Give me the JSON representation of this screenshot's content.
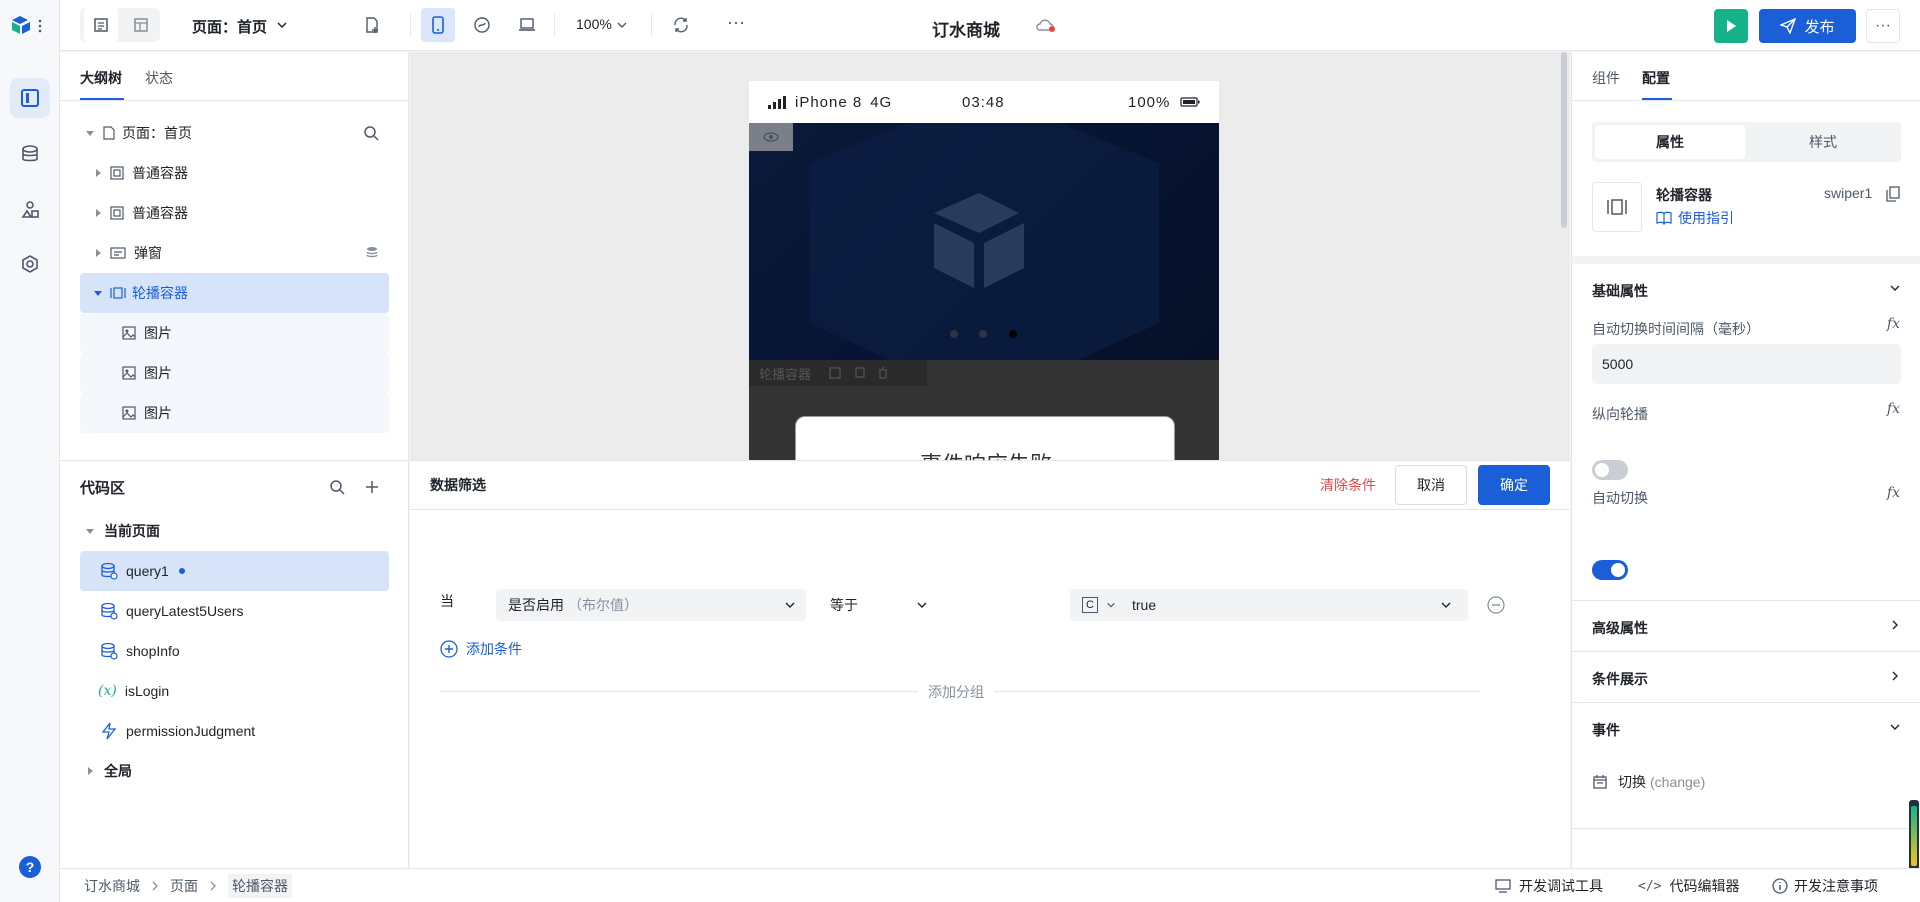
{
  "app": {
    "title": "订水商城"
  },
  "toolbar": {
    "page_selector": "页面：首页",
    "zoom": "100%",
    "more": "···",
    "publish_label": "发布"
  },
  "outline": {
    "tabs": [
      "大纲树",
      "状态"
    ],
    "root": "页面：首页",
    "items": [
      {
        "label": "普通容器"
      },
      {
        "label": "普通容器"
      },
      {
        "label": "弹窗"
      },
      {
        "label": "轮播容器"
      },
      {
        "label": "图片"
      },
      {
        "label": "图片"
      },
      {
        "label": "图片"
      }
    ]
  },
  "code_area": {
    "title": "代码区",
    "current_page": "当前页面",
    "items": [
      "query1",
      "queryLatest5Users",
      "shopInfo",
      "isLogin",
      "permissionJudgment"
    ],
    "global": "全局"
  },
  "phone": {
    "device": "iPhone 8",
    "network": "4G",
    "time": "03:48",
    "battery": "100%",
    "component_tag": "轮播容器",
    "modal_text": "事件响应失败"
  },
  "filter": {
    "title": "数据筛选",
    "clear_label": "清除条件",
    "cancel_label": "取消",
    "confirm_label": "确定",
    "when_label": "当",
    "field_label": "是否启用",
    "field_type": "（布尔值）",
    "operator": "等于",
    "value_type_badge": "C",
    "value": "true",
    "add_condition": "添加条件",
    "add_group": "添加分组"
  },
  "right_panel": {
    "tabs": [
      "组件",
      "配置"
    ],
    "segments": [
      "属性",
      "样式"
    ],
    "component_name": "轮播容器",
    "component_id": "swiper1",
    "guide_link": "使用指引",
    "basic_section": "基础属性",
    "interval_label": "自动切换时间间隔（毫秒）",
    "interval_value": "5000",
    "vertical_label": "纵向轮播",
    "vertical_on": false,
    "autoplay_label": "自动切换",
    "autoplay_on": true,
    "fx_label": "fx",
    "advanced_section": "高级属性",
    "condition_section": "条件展示",
    "events_section": "事件",
    "event_name": "切换",
    "event_code": "(change)"
  },
  "statusbar": {
    "breadcrumb": [
      "订水商城",
      "页面",
      "轮播容器"
    ],
    "dev_tools": "开发调试工具",
    "code_editor": "代码编辑器",
    "dev_notes": "开发注意事项",
    "help": "?"
  },
  "colors": {
    "accent": "#1a5fd8",
    "run_green": "#16b38a",
    "danger": "#e5484d"
  }
}
